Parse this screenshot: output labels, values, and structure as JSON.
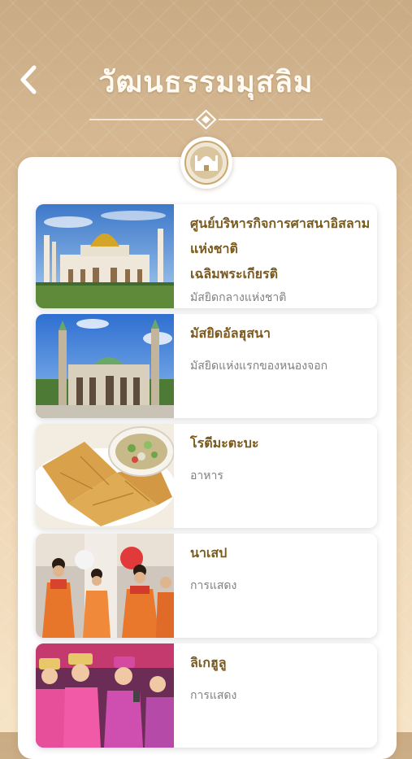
{
  "header": {
    "title": "วัฒนธรรมมุสลิม",
    "back_icon": "chevron-left-icon"
  },
  "emblem_icon": "mosque-emblem-icon",
  "items": [
    {
      "name": "ศูนย์บริหารกิจการศาสนาอิสลาม\nแห่งชาติ\nเฉลิมพระเกียรติ",
      "category": "มัสยิดกลางแห่งชาติ",
      "image": "golden-dome-mosque"
    },
    {
      "name": "มัสยิดอัลฮุสนา",
      "category": "มัสยิดแห่งแรกของหนองจอก",
      "image": "green-dome-mosque"
    },
    {
      "name": "โรตีมะตะบะ",
      "category": "อาหาร",
      "image": "roti-mataba-food"
    },
    {
      "name": "นาเสป",
      "category": "การแสดง",
      "image": "dancers-performance"
    },
    {
      "name": "ลิเกฮูลู",
      "category": "การแสดง",
      "image": "likay-performers"
    }
  ],
  "colors": {
    "title": "#fffaf2",
    "item_name": "#7a5a1e",
    "item_sub": "#808080",
    "background": "#dcc09a"
  }
}
